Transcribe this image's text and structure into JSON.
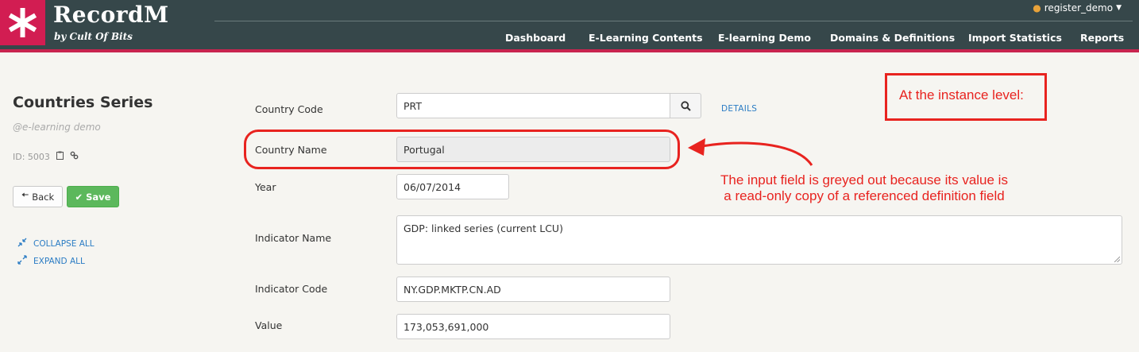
{
  "brand": {
    "name": "RecordM",
    "tagline": "by Cult Of Bits"
  },
  "user_menu": {
    "username": "register_demo"
  },
  "nav": {
    "items": [
      {
        "label": "Dashboard"
      },
      {
        "label": "E-Learning Contents"
      },
      {
        "label": "E-learning Demo"
      },
      {
        "label": "Domains & Definitions"
      },
      {
        "label": "Import Statistics"
      },
      {
        "label": "Reports"
      }
    ]
  },
  "sidebar": {
    "title": "Countries Series",
    "subtitle": "@e-learning demo",
    "id_text": "ID: 5003",
    "back_label": "Back",
    "save_label": "Save",
    "collapse_label": "COLLAPSE ALL",
    "expand_label": "EXPAND ALL"
  },
  "form": {
    "country_code": {
      "label": "Country Code",
      "value": "PRT"
    },
    "details_label": "DETAILS",
    "country_name": {
      "label": "Country Name",
      "value": "Portugal"
    },
    "year": {
      "label": "Year",
      "value": "06/07/2014"
    },
    "indicator_name": {
      "label": "Indicator Name",
      "value": "GDP: linked series (current LCU)"
    },
    "indicator_code": {
      "label": "Indicator Code",
      "value": "NY.GDP.MKTP.CN.AD"
    },
    "value": {
      "label": "Value",
      "value": "173,053,691,000"
    }
  },
  "annotations": {
    "box_text": "At the instance level:",
    "note_line1": "The input field is greyed out because its value is",
    "note_line2": "a read-only copy of a referenced definition field"
  },
  "colors": {
    "header_bg": "#36474a",
    "brand_accent": "#d21d52",
    "link": "#2b7cc4",
    "save_button": "#5cb85c",
    "annotation": "#e8231f"
  }
}
